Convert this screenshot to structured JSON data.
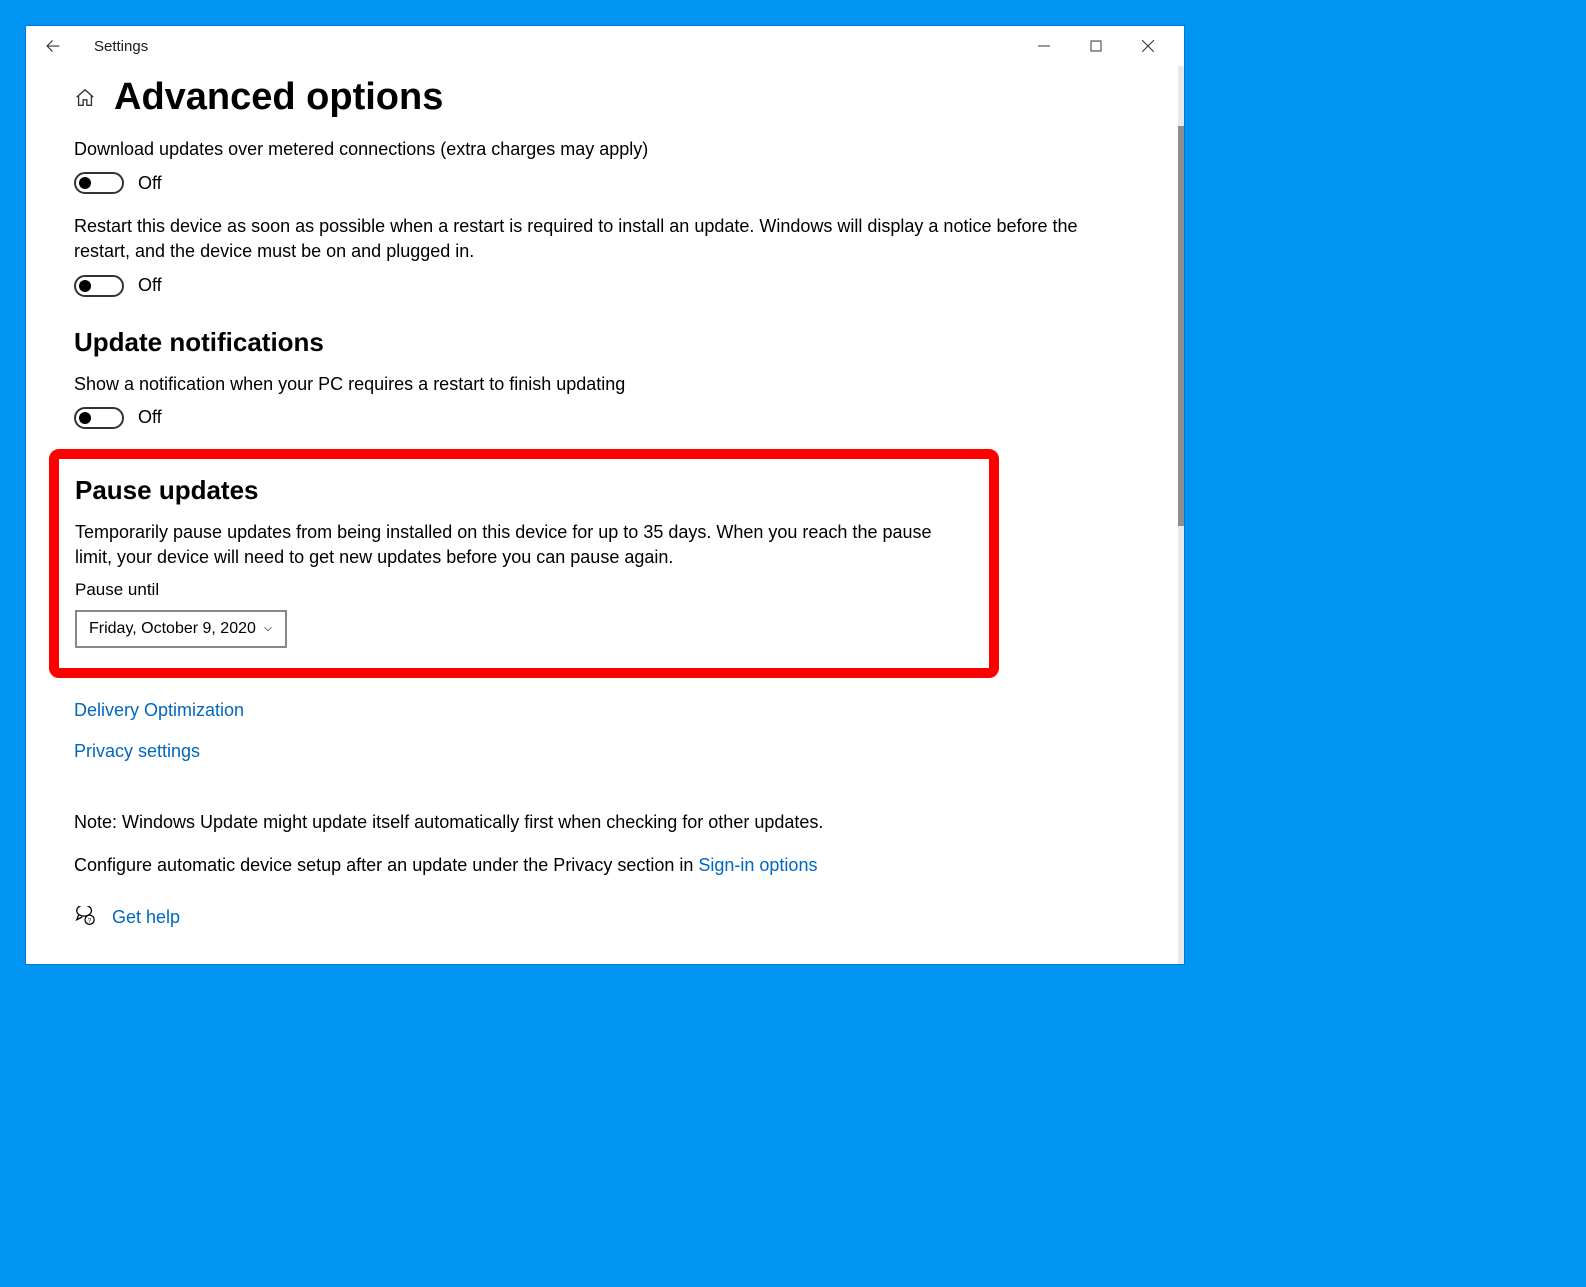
{
  "titlebar": {
    "title": "Settings"
  },
  "page": {
    "title": "Advanced options"
  },
  "metered": {
    "desc": "Download updates over metered connections (extra charges may apply)",
    "state_label": "Off"
  },
  "restart": {
    "desc": "Restart this device as soon as possible when a restart is required to install an update. Windows will display a notice before the restart, and the device must be on and plugged in.",
    "state_label": "Off"
  },
  "notifications": {
    "heading": "Update notifications",
    "desc": "Show a notification when your PC requires a restart to finish updating",
    "state_label": "Off"
  },
  "pause": {
    "heading": "Pause updates",
    "desc": "Temporarily pause updates from being installed on this device for up to 35 days. When you reach the pause limit, your device will need to get new updates before you can pause again.",
    "until_label": "Pause until",
    "until_value": "Friday, October 9, 2020"
  },
  "links": {
    "delivery": "Delivery Optimization",
    "privacy": "Privacy settings",
    "signin": "Sign-in options",
    "help": "Get help"
  },
  "note": "Note: Windows Update might update itself automatically first when checking for other updates.",
  "configure_prefix": "Configure automatic device setup after an update under the Privacy section in "
}
